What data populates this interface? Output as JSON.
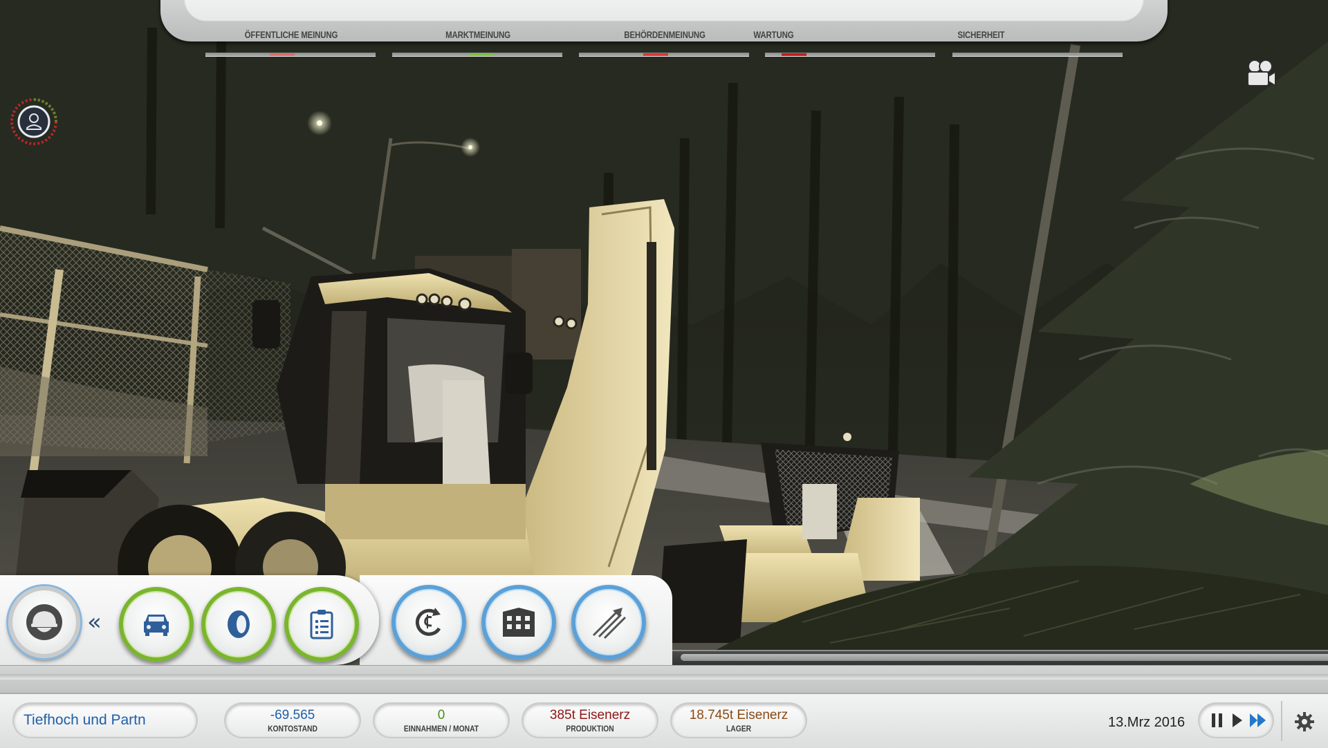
{
  "meters": [
    {
      "label": "ÖFFENTLICHE MEINUNG",
      "value": 0.45,
      "color": "#e06b6b"
    },
    {
      "label": "MARKTMEINUNG",
      "value": 0.52,
      "color": "#7dc043"
    },
    {
      "label": "BEHÖRDENMEINUNG",
      "value": 0.45,
      "color": "#e03434"
    },
    {
      "label": "WARTUNG",
      "value": 0.17,
      "color": "#c81c1c"
    },
    {
      "label": "SICHERHEIT",
      "value": 0.0,
      "color": "#cccccc"
    }
  ],
  "menu": {
    "main_button_icon": "helmet-icon",
    "collapse_label": "«",
    "green_buttons": [
      "vehicle-icon",
      "tire-icon",
      "clipboard-icon"
    ],
    "blue_buttons": [
      "money-cycle-icon",
      "building-icon",
      "arrows-icon"
    ]
  },
  "status": {
    "company": "Tiefhoch und Partn",
    "balance": {
      "value": "-69.565",
      "label": "KONTOSTAND",
      "color": "#1f5fa8"
    },
    "income": {
      "value": "0",
      "label": "EINNAHMEN / MONAT",
      "color": "#4b8b1a"
    },
    "production": {
      "value": "385t Eisenerz",
      "label": "PRODUKTION",
      "color": "#8e1515"
    },
    "storage": {
      "value": "18.745t Eisenerz",
      "label": "LAGER",
      "color": "#8a4a12"
    },
    "date": "13.Mrz 2016"
  },
  "controls": {
    "speed_icons": [
      "pause-icon",
      "play-icon",
      "fast-forward-icon"
    ],
    "settings_icon": "gear-icon",
    "camera_icon": "camera-icon",
    "profile_icon": "profile-icon"
  }
}
